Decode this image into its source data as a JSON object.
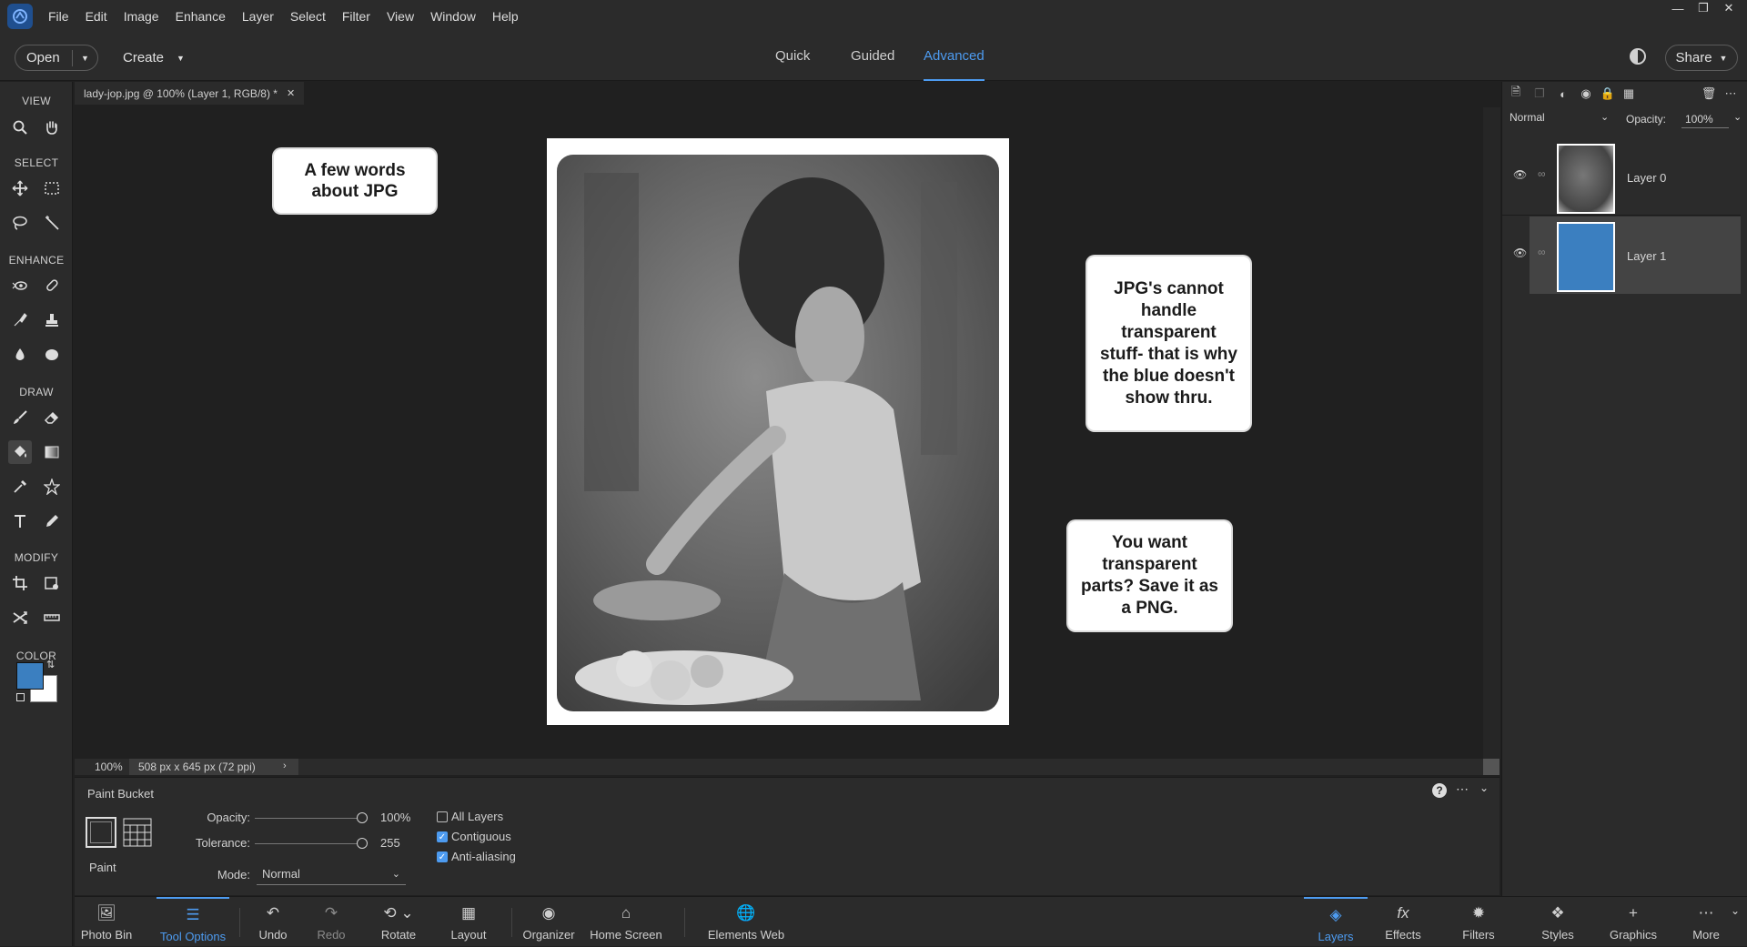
{
  "menu": [
    "File",
    "Edit",
    "Image",
    "Enhance",
    "Layer",
    "Select",
    "Filter",
    "View",
    "Window",
    "Help"
  ],
  "topbar": {
    "open_label": "Open",
    "create_label": "Create",
    "modes": [
      "Quick",
      "Guided",
      "Advanced"
    ],
    "active_mode": "Advanced",
    "share_label": "Share"
  },
  "toolbar": {
    "sections": [
      "VIEW",
      "SELECT",
      "ENHANCE",
      "DRAW",
      "MODIFY",
      "COLOR"
    ],
    "foreground_color": "#3b7fc0",
    "background_color": "#ffffff"
  },
  "document": {
    "tab_title": "lady-jop.jpg @ 100% (Layer 1, RGB/8) *",
    "zoom": "100%",
    "dimensions": "508 px x 645 px (72 ppi)"
  },
  "callouts": {
    "c1": "A few  words about JPG",
    "c2": "JPG's cannot handle transparent stuff- that is why the blue doesn't show thru.",
    "c3": "You want transparent parts?  Save it as a PNG."
  },
  "tool_options": {
    "tool_name": "Paint Bucket",
    "fill_label": "Paint",
    "opacity_label": "Opacity:",
    "opacity_value": "100%",
    "tolerance_label": "Tolerance:",
    "tolerance_value": "255",
    "mode_label": "Mode:",
    "mode_value": "Normal",
    "all_layers": "All Layers",
    "contiguous": "Contiguous",
    "anti_aliasing": "Anti-aliasing",
    "opacity_fraction": 1.0,
    "tolerance_fraction": 1.0
  },
  "taskbar": {
    "photo_bin": "Photo Bin",
    "tool_options": "Tool Options",
    "undo": "Undo",
    "redo": "Redo",
    "rotate": "Rotate",
    "layout": "Layout",
    "organizer": "Organizer",
    "home_screen": "Home Screen",
    "elements_web": "Elements Web",
    "layers": "Layers",
    "effects": "Effects",
    "filters": "Filters",
    "styles": "Styles",
    "graphics": "Graphics",
    "more": "More"
  },
  "layers_panel": {
    "blend_mode": "Normal",
    "opacity_label": "Opacity:",
    "opacity_value": "100%",
    "layers": [
      {
        "name": "Layer 0",
        "selected": false
      },
      {
        "name": "Layer 1",
        "selected": true,
        "fill": "#3b7fc0"
      }
    ]
  }
}
